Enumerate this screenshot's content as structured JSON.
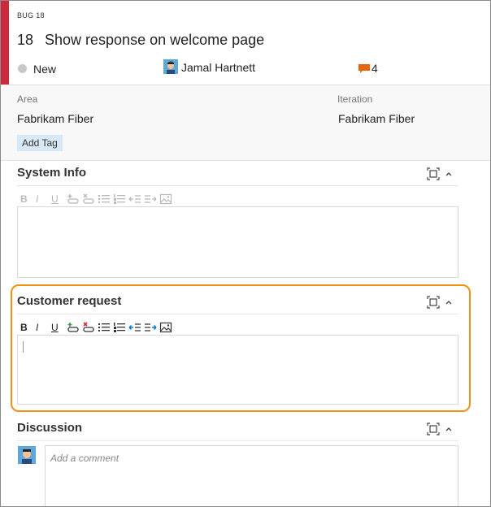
{
  "work_item": {
    "type_label": "BUG 18",
    "id": "18",
    "title": "Show response on welcome page",
    "state": "New",
    "assigned_to": "Jamal Hartnett",
    "comment_count": "4",
    "type_color": "#cc293d"
  },
  "fields": {
    "area_label": "Area",
    "area_value": "Fabrikam Fiber",
    "iteration_label": "Iteration",
    "iteration_value": "Fabrikam Fiber",
    "add_tag_label": "Add Tag"
  },
  "sections": {
    "system_info": {
      "title": "System Info"
    },
    "customer_request": {
      "title": "Customer request"
    },
    "discussion": {
      "title": "Discussion",
      "comment_placeholder": "Add a comment"
    }
  },
  "toolbar": {
    "bold": "B",
    "italic": "I",
    "underline": "U",
    "icons": [
      "add-link-icon",
      "remove-link-icon",
      "bulleted-list-icon",
      "numbered-list-icon",
      "decrease-indent-icon",
      "increase-indent-icon",
      "insert-image-icon"
    ]
  },
  "colors": {
    "highlight": "#f29111",
    "accent": "#0078d7",
    "comment_icon": "#e8650f"
  }
}
